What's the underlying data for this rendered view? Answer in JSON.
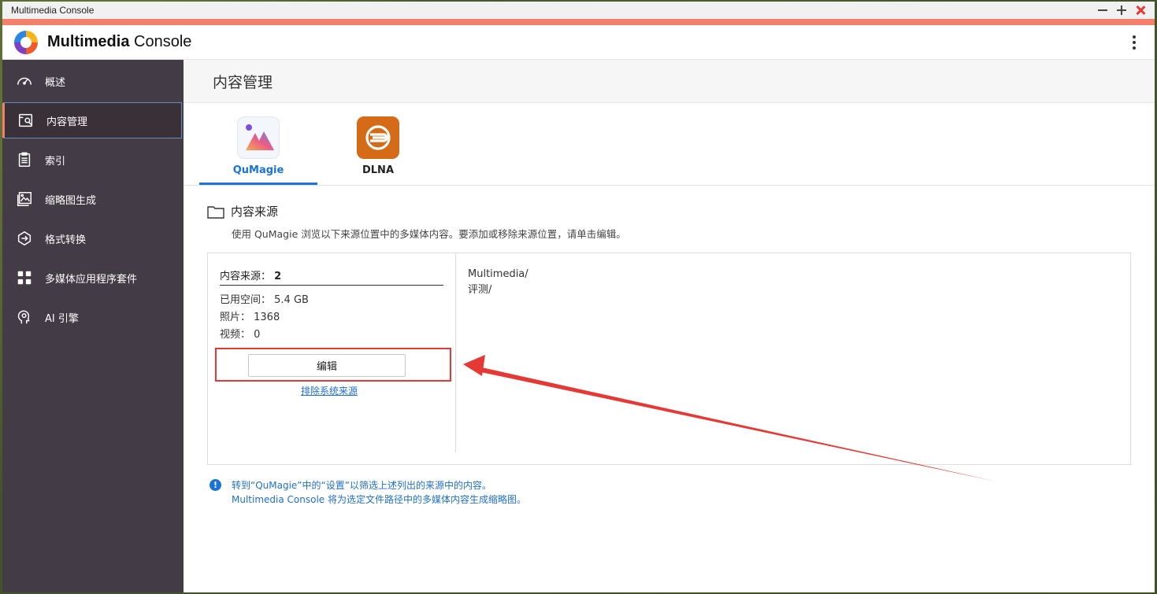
{
  "window": {
    "title": "Multimedia Console"
  },
  "app": {
    "title_bold": "Multimedia",
    "title_rest": " Console"
  },
  "sidebar": {
    "items": [
      {
        "label": "概述",
        "icon": "gauge-icon"
      },
      {
        "label": "内容管理",
        "icon": "content-manage-icon"
      },
      {
        "label": "索引",
        "icon": "clipboard-icon"
      },
      {
        "label": "缩略图生成",
        "icon": "image-icon"
      },
      {
        "label": "格式转换",
        "icon": "transcode-icon"
      },
      {
        "label": "多媒体应用程序套件",
        "icon": "grid-icon"
      },
      {
        "label": "AI 引擎",
        "icon": "ai-head-icon"
      }
    ],
    "active_index": 1
  },
  "page": {
    "title": "内容管理"
  },
  "tabs": [
    {
      "label": "QuMagie"
    },
    {
      "label": "DLNA"
    }
  ],
  "section": {
    "title": "内容来源",
    "description": "使用 QuMagie 浏览以下来源位置中的多媒体内容。要添加或移除来源位置，请单击编辑。"
  },
  "stats": {
    "source_label": "内容来源：",
    "source_count": "2",
    "used_space": "已用空间：  5.4 GB",
    "photos": "照片：  1368",
    "videos": "视频：  0"
  },
  "buttons": {
    "edit": "编辑",
    "exclude_link": "排除系统来源"
  },
  "sources": [
    "Multimedia/",
    "评测/"
  ],
  "note": {
    "line1": "转到“QuMagie”中的“设置”以筛选上述列出的来源中的内容。",
    "line2": "Multimedia Console 将为选定文件路径中的多媒体内容生成缩略图。"
  },
  "colors": {
    "accent": "#f4806b",
    "sidebar": "#433b45",
    "link": "#1f6fd1",
    "annotation": "#e53935"
  }
}
